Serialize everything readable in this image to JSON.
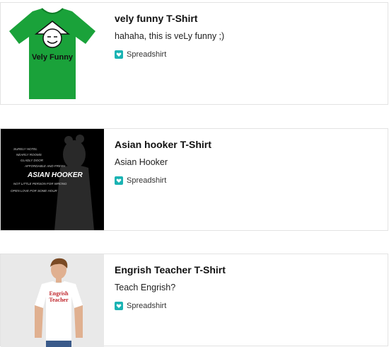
{
  "products": [
    {
      "title": "vely funny T-Shirt",
      "description": "hahaha, this is veLy funny ;)",
      "shop": "Spreadshirt",
      "shirt_text": "Vely Funny",
      "shirt_color": "#1aa23a"
    },
    {
      "title": "Asian hooker T-Shirt",
      "description": "Asian Hooker",
      "shop": "Spreadshirt",
      "shirt_text": "ASIAN HOOKER",
      "background_color": "#000000",
      "small_lines": [
        "SURELY HOTEL",
        "NEARLY ROOMS",
        "GLADLY DOOR",
        "AFFORDABLE AND FRESH",
        "NOT LITTLE PERSON FOR WRONG",
        "OPEN LOVE FOR SOME HOUR"
      ]
    },
    {
      "title": "Engrish Teacher T-Shirt",
      "description": "Teach Engrish?",
      "shop": "Spreadshirt",
      "shirt_text_line1": "Engrish",
      "shirt_text_line2": "Teacher",
      "shirt_text_color": "#c0272d"
    }
  ],
  "colors": {
    "accent": "#1ab3b3",
    "border": "#e3e3e3"
  },
  "icons": {
    "shop": "heart-in-box-icon"
  }
}
